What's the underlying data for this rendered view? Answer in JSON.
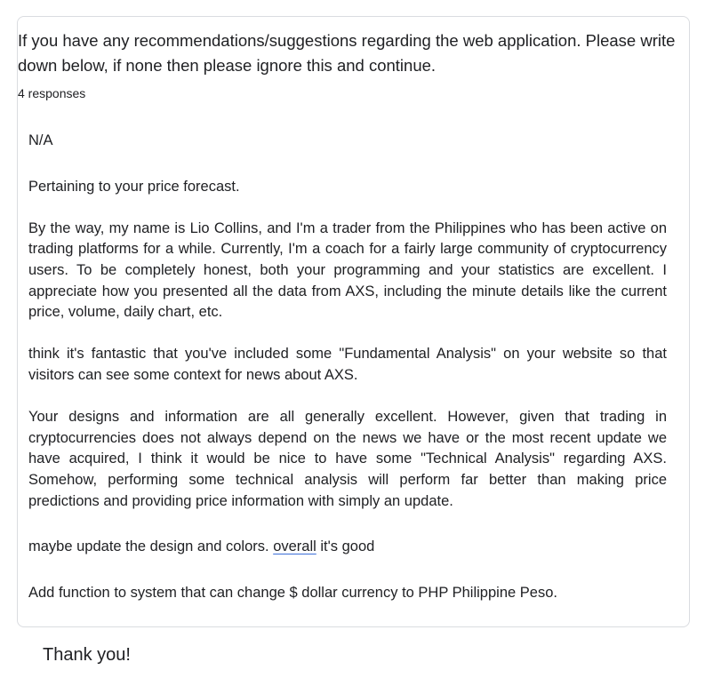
{
  "question": {
    "title": "If you have any recommendations/suggestions regarding the web application. Please write down below, if none then please ignore this and continue.",
    "response_count": "4 responses"
  },
  "responses": {
    "na": "N/A",
    "long": {
      "p1": "Pertaining to your price forecast.",
      "p2": "By the way, my name is Lio Collins, and I'm a trader from the Philippines who has been active on trading platforms for a while. Currently, I'm a coach for a fairly large community of cryptocurrency users. To be completely honest, both your programming and your statistics are excellent. I appreciate how you presented all the data from AXS, including the minute details like the current price, volume, daily chart, etc.",
      "p3": "think it's fantastic that you've included some \"Fundamental Analysis\" on your website so that visitors can see some context for news about AXS.",
      "p4": "Your designs and information are all generally excellent. However, given that trading in cryptocurrencies does not always depend on the news we have or the most recent update we have acquired, I think it would be nice to have some \"Technical Analysis\" regarding AXS. Somehow, performing some technical analysis will perform far better than making price predictions and providing price information with simply an update."
    },
    "design": {
      "before": "maybe update the design and colors. ",
      "underlined": "overall",
      "after": " it's good"
    },
    "currency": "Add function to system that can change $ dollar currency to PHP Philippine Peso."
  },
  "footer": {
    "thanks": "Thank you!"
  }
}
